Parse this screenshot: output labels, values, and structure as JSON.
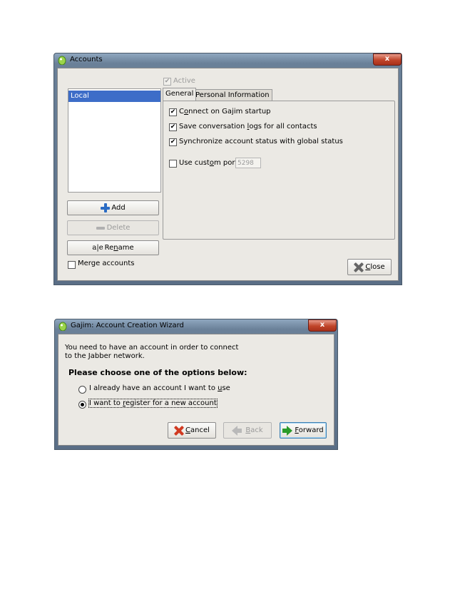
{
  "accounts_window": {
    "title": "Accounts",
    "close_x": "x",
    "accounts": [
      {
        "name": "Local",
        "selected": true
      }
    ],
    "buttons": {
      "add": "Add",
      "delete": "Delete",
      "rename_prefix": "Re",
      "rename_underline": "n",
      "rename_suffix": "ame"
    },
    "merge_accounts": {
      "label": "Merge accounts",
      "checked": false
    },
    "active": {
      "label": "Active",
      "checked": true,
      "enabled": false
    },
    "tabs": [
      {
        "label": "General",
        "active": true
      },
      {
        "label": "Personal Information",
        "active": false
      }
    ],
    "general": {
      "connect_prefix": "C",
      "connect_underline": "o",
      "connect_suffix": "nnect on Gajim startup",
      "save_prefix": "Save conversation ",
      "save_underline": "l",
      "save_suffix": "ogs for all contacts",
      "sync_label": "Synchronize account status with global status",
      "port_prefix": "Use cust",
      "port_underline": "o",
      "port_suffix": "m port:",
      "port_value": "5298"
    },
    "close_button": {
      "underline": "C",
      "rest": "lose"
    }
  },
  "wizard_window": {
    "title": "Gajim: Account Creation Wizard",
    "close_x": "x",
    "intro_line1": "You need to have an account in order to connect",
    "intro_line2": "to the Jabber network.",
    "prompt": "Please choose one of the options below:",
    "option1_prefix": "I already have an account I want to ",
    "option1_underline": "u",
    "option1_suffix": "se",
    "option2_prefix": "I want to ",
    "option2_underline": "r",
    "option2_suffix": "egister for a new account",
    "selected_option": 2,
    "cancel": {
      "underline": "C",
      "rest": "ancel"
    },
    "back": {
      "underline": "B",
      "rest": "ack"
    },
    "forward": {
      "underline": "F",
      "rest": "orward"
    }
  },
  "colors": {
    "selection": "#3d6dc8",
    "window_bg": "#ebe9e4",
    "close_red": "#c0452a"
  }
}
